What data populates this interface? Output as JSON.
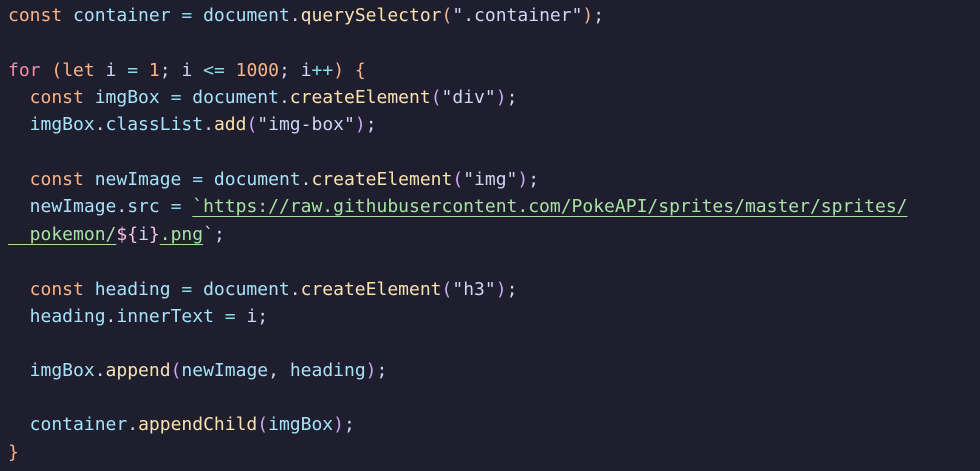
{
  "editor": {
    "lines": [
      {
        "tokens": [
          {
            "t": "const ",
            "c": "k-orange"
          },
          {
            "t": "container",
            "c": "ident"
          },
          {
            "t": " = ",
            "c": "op"
          },
          {
            "t": "document",
            "c": "ident"
          },
          {
            "t": ".",
            "c": "punc"
          },
          {
            "t": "querySelector",
            "c": "method"
          },
          {
            "t": "(",
            "c": "p1"
          },
          {
            "t": "\".container\"",
            "c": "str"
          },
          {
            "t": ")",
            "c": "p1"
          },
          {
            "t": ";",
            "c": "punc"
          }
        ]
      },
      {
        "tokens": []
      },
      {
        "tokens": [
          {
            "t": "for",
            "c": "k-pink"
          },
          {
            "t": " (",
            "c": "p1"
          },
          {
            "t": "let",
            "c": "k-orange"
          },
          {
            "t": " i",
            "c": "plain"
          },
          {
            "t": " = ",
            "c": "op"
          },
          {
            "t": "1",
            "c": "num"
          },
          {
            "t": "; ",
            "c": "punc"
          },
          {
            "t": "i",
            "c": "plain"
          },
          {
            "t": " <= ",
            "c": "op"
          },
          {
            "t": "1000",
            "c": "num"
          },
          {
            "t": "; ",
            "c": "punc"
          },
          {
            "t": "i",
            "c": "plain"
          },
          {
            "t": "++",
            "c": "op"
          },
          {
            "t": ") {",
            "c": "p1"
          }
        ]
      },
      {
        "tokens": [
          {
            "t": "  const ",
            "c": "k-orange"
          },
          {
            "t": "imgBox",
            "c": "ident"
          },
          {
            "t": " = ",
            "c": "op"
          },
          {
            "t": "document",
            "c": "ident"
          },
          {
            "t": ".",
            "c": "punc"
          },
          {
            "t": "createElement",
            "c": "method"
          },
          {
            "t": "(",
            "c": "p2"
          },
          {
            "t": "\"div\"",
            "c": "str"
          },
          {
            "t": ")",
            "c": "p2"
          },
          {
            "t": ";",
            "c": "punc"
          }
        ]
      },
      {
        "tokens": [
          {
            "t": "  imgBox",
            "c": "ident"
          },
          {
            "t": ".",
            "c": "punc"
          },
          {
            "t": "classList",
            "c": "ident"
          },
          {
            "t": ".",
            "c": "punc"
          },
          {
            "t": "add",
            "c": "method"
          },
          {
            "t": "(",
            "c": "p2"
          },
          {
            "t": "\"img-box\"",
            "c": "str"
          },
          {
            "t": ")",
            "c": "p2"
          },
          {
            "t": ";",
            "c": "punc"
          }
        ]
      },
      {
        "tokens": []
      },
      {
        "tokens": [
          {
            "t": "  const ",
            "c": "k-orange"
          },
          {
            "t": "newImage",
            "c": "ident"
          },
          {
            "t": " = ",
            "c": "op"
          },
          {
            "t": "document",
            "c": "ident"
          },
          {
            "t": ".",
            "c": "punc"
          },
          {
            "t": "createElement",
            "c": "method"
          },
          {
            "t": "(",
            "c": "p2"
          },
          {
            "t": "\"img\"",
            "c": "str"
          },
          {
            "t": ")",
            "c": "p2"
          },
          {
            "t": ";",
            "c": "punc"
          }
        ]
      },
      {
        "tokens": [
          {
            "t": "  newImage",
            "c": "ident"
          },
          {
            "t": ".",
            "c": "punc"
          },
          {
            "t": "src",
            "c": "ident"
          },
          {
            "t": " = ",
            "c": "op"
          },
          {
            "t": "`",
            "c": "url"
          },
          {
            "t": "https://raw.githubusercontent.com/PokeAPI/sprites/master/sprites/",
            "c": "url"
          }
        ]
      },
      {
        "tokens": [
          {
            "t": "  pokemon/",
            "c": "url"
          },
          {
            "t": "${",
            "c": "tmpl"
          },
          {
            "t": "i",
            "c": "plain"
          },
          {
            "t": "}",
            "c": "tmpl"
          },
          {
            "t": ".png",
            "c": "url"
          },
          {
            "t": "`",
            "c": "punc"
          },
          {
            "t": ";",
            "c": "punc"
          }
        ]
      },
      {
        "tokens": []
      },
      {
        "tokens": [
          {
            "t": "  const ",
            "c": "k-orange"
          },
          {
            "t": "heading",
            "c": "ident"
          },
          {
            "t": " = ",
            "c": "op"
          },
          {
            "t": "document",
            "c": "ident"
          },
          {
            "t": ".",
            "c": "punc"
          },
          {
            "t": "createElement",
            "c": "method"
          },
          {
            "t": "(",
            "c": "p2"
          },
          {
            "t": "\"h3\"",
            "c": "str"
          },
          {
            "t": ")",
            "c": "p2"
          },
          {
            "t": ";",
            "c": "punc"
          }
        ]
      },
      {
        "tokens": [
          {
            "t": "  heading",
            "c": "ident"
          },
          {
            "t": ".",
            "c": "punc"
          },
          {
            "t": "innerText",
            "c": "ident"
          },
          {
            "t": " = ",
            "c": "op"
          },
          {
            "t": "i",
            "c": "plain"
          },
          {
            "t": ";",
            "c": "punc"
          }
        ]
      },
      {
        "tokens": []
      },
      {
        "tokens": [
          {
            "t": "  imgBox",
            "c": "ident"
          },
          {
            "t": ".",
            "c": "punc"
          },
          {
            "t": "append",
            "c": "method"
          },
          {
            "t": "(",
            "c": "p2"
          },
          {
            "t": "newImage",
            "c": "ident"
          },
          {
            "t": ", ",
            "c": "punc"
          },
          {
            "t": "heading",
            "c": "ident"
          },
          {
            "t": ")",
            "c": "p2"
          },
          {
            "t": ";",
            "c": "punc"
          }
        ]
      },
      {
        "tokens": []
      },
      {
        "tokens": [
          {
            "t": "  container",
            "c": "ident"
          },
          {
            "t": ".",
            "c": "punc"
          },
          {
            "t": "appendChild",
            "c": "method"
          },
          {
            "t": "(",
            "c": "p2"
          },
          {
            "t": "imgBox",
            "c": "ident"
          },
          {
            "t": ")",
            "c": "p2"
          },
          {
            "t": ";",
            "c": "punc"
          }
        ]
      },
      {
        "tokens": [
          {
            "t": "}",
            "c": "p1"
          }
        ]
      }
    ]
  }
}
